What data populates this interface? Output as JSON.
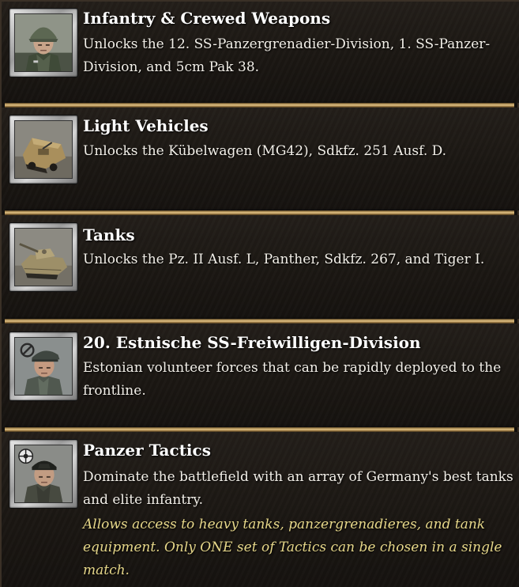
{
  "entries": [
    {
      "title": "Infantry & Crewed Weapons",
      "description": "Unlocks the 12. SS-Panzergrenadier-Division, 1. SS-Panzer-Division, and 5cm Pak 38.",
      "icon": "infantry-soldier-portrait-icon"
    },
    {
      "title": "Light Vehicles",
      "description": "Unlocks the Kübelwagen (MG42), Sdkfz. 251 Ausf. D.",
      "icon": "halftrack-vehicle-icon"
    },
    {
      "title": "Tanks",
      "description": "Unlocks the Pz. II Ausf. L, Panther, Sdkfz. 267, and Tiger I.",
      "icon": "tiger-tank-icon"
    },
    {
      "title": "20. Estnische SS-Freiwilligen-Division",
      "description": "Estonian volunteer forces that can be rapidly deployed to the frontline.",
      "icon": "estonian-soldier-portrait-icon"
    },
    {
      "title": "Panzer Tactics",
      "description": "Dominate the battlefield with an array of Germany's best tanks and elite infantry.",
      "note": "Allows access to heavy tanks, panzergrenadieres, and tank equipment. Only ONE set of Tactics can be chosen in a single match.",
      "icon": "tank-commander-portrait-icon"
    }
  ],
  "colors": {
    "title": "#ffffff",
    "description": "#f2efe8",
    "note": "#e7d88a",
    "divider": "#c9a86a"
  }
}
